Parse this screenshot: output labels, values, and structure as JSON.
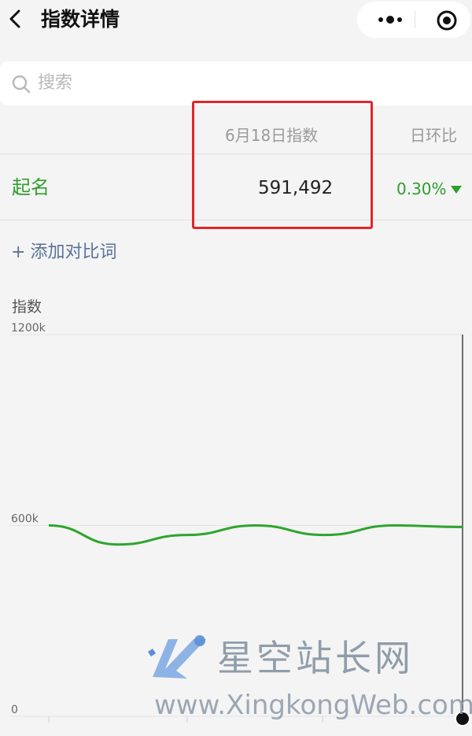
{
  "header": {
    "title": "指数详情",
    "more_icon": "more-dots-icon",
    "capsule_icon": "target-icon",
    "back_icon": "chevron-left-icon"
  },
  "search": {
    "placeholder": "搜索"
  },
  "table": {
    "date_header": "6月18日指数",
    "ratio_header": "日环比",
    "keyword": "起名",
    "index_value": "591,492",
    "ratio_value": "0.30%",
    "ratio_direction": "down",
    "accent_color": "#2f9e2f",
    "highlight_color": "#e3242b"
  },
  "add_compare": {
    "label": "添加对比词"
  },
  "chart_data": {
    "type": "line",
    "ylabel": "指数",
    "yticks": [
      "1200k",
      "600k",
      "0"
    ],
    "ylim": [
      0,
      1200000
    ],
    "series": [
      {
        "values": [
          600000,
          540000,
          570000,
          600000,
          570000,
          600000,
          595000
        ]
      }
    ],
    "color": "#2ea52e",
    "grid": true
  },
  "watermark": {
    "title": "星空站长网",
    "url": "www.XingkongWeb.com"
  }
}
